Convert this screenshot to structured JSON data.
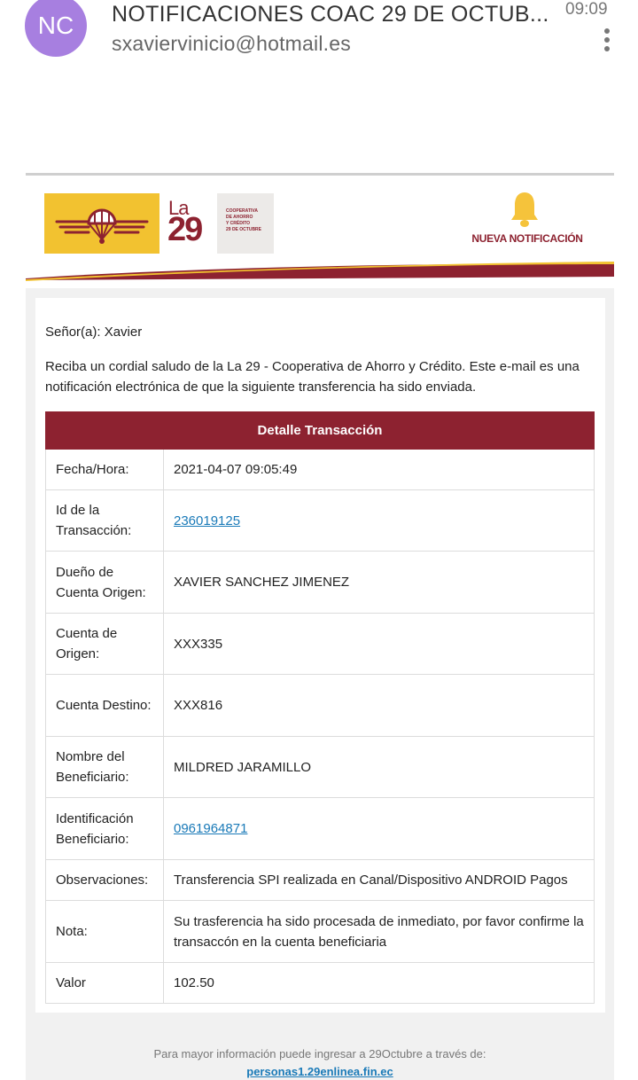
{
  "header": {
    "avatar_initials": "NC",
    "subject": "NOTIFICACIONES COAC 29 DE OCTUB...",
    "sender_email": "sxaviervinicio@hotmail.es",
    "time": "09:09"
  },
  "banner": {
    "logo_la": "La",
    "logo_29": "29",
    "coop_text": [
      "COOPERATIVA",
      "DE AHORRO",
      "Y CRÉDITO",
      "29 DE OCTUBRE"
    ],
    "notice_label": "NUEVA NOTIFICACIÓN",
    "colors": {
      "brand_red": "#8d2230",
      "brand_yellow": "#f2c230",
      "bell": "#f5c33b"
    }
  },
  "email": {
    "greeting": "Señor(a): Xavier",
    "intro": "Reciba un cordial saludo de la La 29 - Cooperativa de Ahorro y Crédito. Este e-mail es una notificación electrónica de que la siguiente transferencia ha sido enviada.",
    "table_title": "Detalle Transacción",
    "rows": [
      {
        "label": "Fecha/Hora:",
        "value": "2021-04-07 09:05:49",
        "link": false
      },
      {
        "label": "Id de la Transacción:",
        "value": "236019125",
        "link": true
      },
      {
        "label": "Dueño de Cuenta Origen:",
        "value": "XAVIER SANCHEZ JIMENEZ",
        "link": false
      },
      {
        "label": "Cuenta de Origen:",
        "value": "XXX335",
        "link": false
      },
      {
        "label": "Cuenta Destino:",
        "value": "XXX816",
        "link": false
      },
      {
        "label": "Nombre del Beneficiario:",
        "value": "MILDRED JARAMILLO",
        "link": false
      },
      {
        "label": "Identificación Beneficiario:",
        "value": "0961964871",
        "link": true
      },
      {
        "label": "Observaciones:",
        "value": "Transferencia SPI realizada en Canal/Dispositivo ANDROID Pagos",
        "link": false
      },
      {
        "label": "Nota:",
        "value": "Su trasferencia ha sido procesada de inmediato, por favor confirme la transaccón en la cuenta beneficiaria",
        "link": false
      },
      {
        "label": "Valor",
        "value": "102.50",
        "link": false
      }
    ]
  },
  "footer": {
    "text": "Para mayor información puede ingresar a 29Octubre a través de:",
    "link": "personas1.29enlinea.fin.ec"
  }
}
